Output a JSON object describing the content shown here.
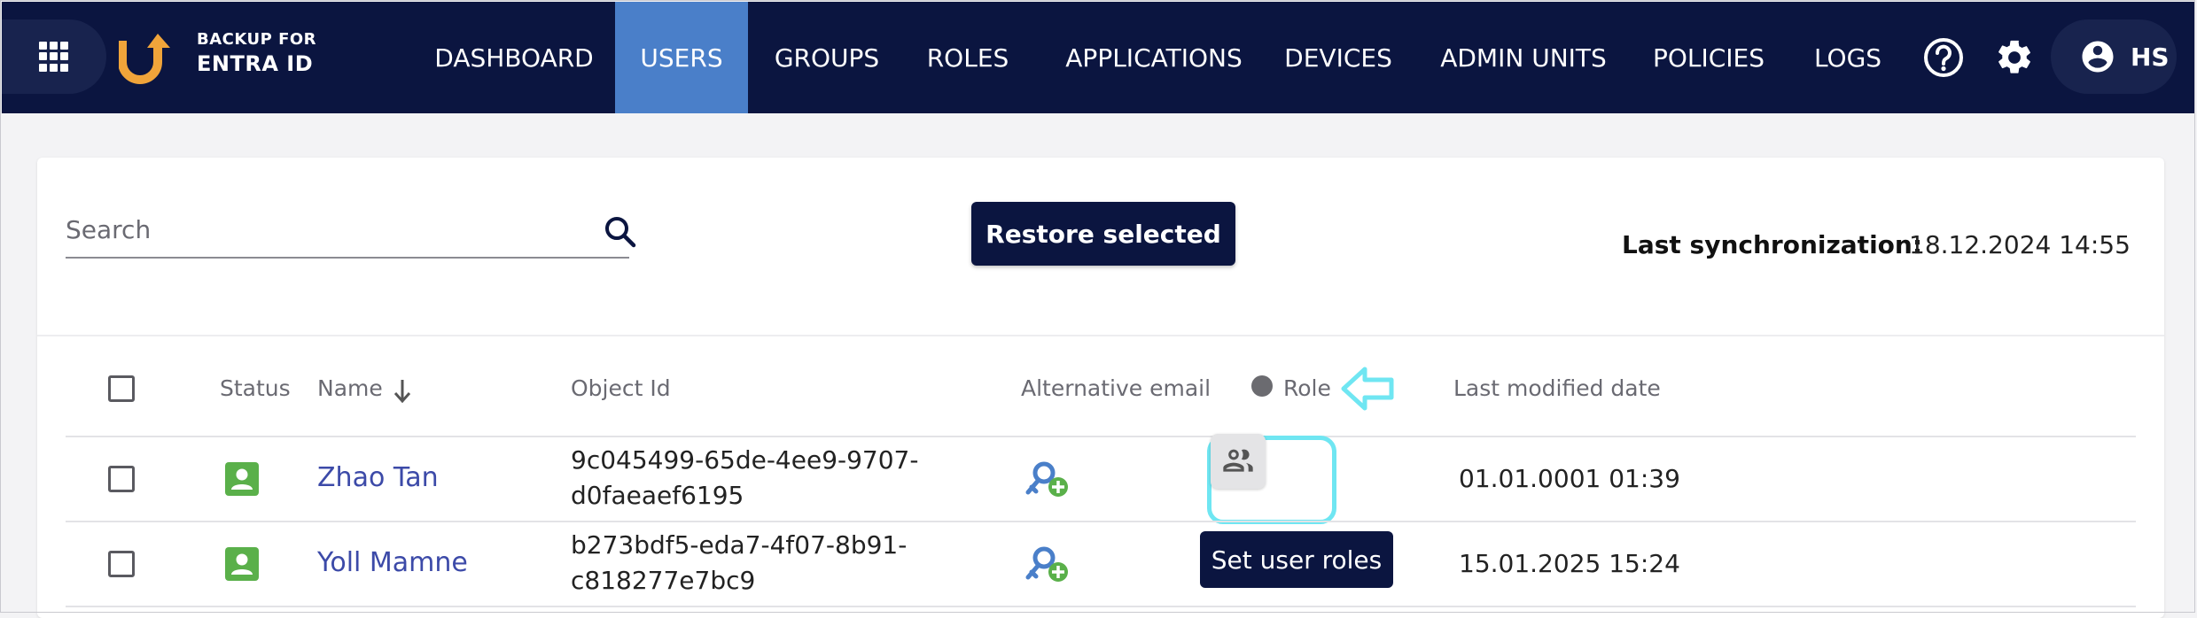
{
  "brand": {
    "line1": "BACKUP FOR",
    "line2": "ENTRA ID"
  },
  "nav": [
    {
      "label": "DASHBOARD"
    },
    {
      "label": "USERS",
      "active": true
    },
    {
      "label": "GROUPS"
    },
    {
      "label": "ROLES"
    },
    {
      "label": "APPLICATIONS"
    },
    {
      "label": "DEVICES"
    },
    {
      "label": "ADMIN UNITS"
    },
    {
      "label": "POLICIES"
    },
    {
      "label": "LOGS"
    }
  ],
  "header": {
    "help_icon": "help-circle-icon",
    "settings_icon": "gear-icon",
    "user_initials": "HS"
  },
  "toolbar": {
    "search_placeholder": "Search",
    "restore_label": "Restore selected",
    "sync_label": "Last synchronization:",
    "sync_value": "18.12.2024 14:55"
  },
  "table": {
    "columns": {
      "status": "Status",
      "name": "Name",
      "object_id": "Object Id",
      "alt_email": "Alternative email",
      "role": "Role",
      "last_modified": "Last modified date"
    },
    "rows": [
      {
        "name": "Zhao Tan",
        "object_id_line1": "9c045499-65de-4ee9-9707-",
        "object_id_line2": "d0faeaef6195",
        "last_modified": "01.01.0001 01:39"
      },
      {
        "name": "Yoll Mamne",
        "object_id_line1": "b273bdf5-eda7-4f07-8b91-",
        "object_id_line2": "c818277e7bc9",
        "last_modified": "15.01.2025 15:24"
      }
    ]
  },
  "tooltip": {
    "text": "Set user roles"
  },
  "colors": {
    "nav_bg": "#0b1540",
    "nav_active": "#4a7fc9",
    "accent_link": "#3c4aa8",
    "status_green": "#5ab04a",
    "highlight_cyan": "#6fe6f2",
    "logo_orange": "#f0a43a"
  }
}
